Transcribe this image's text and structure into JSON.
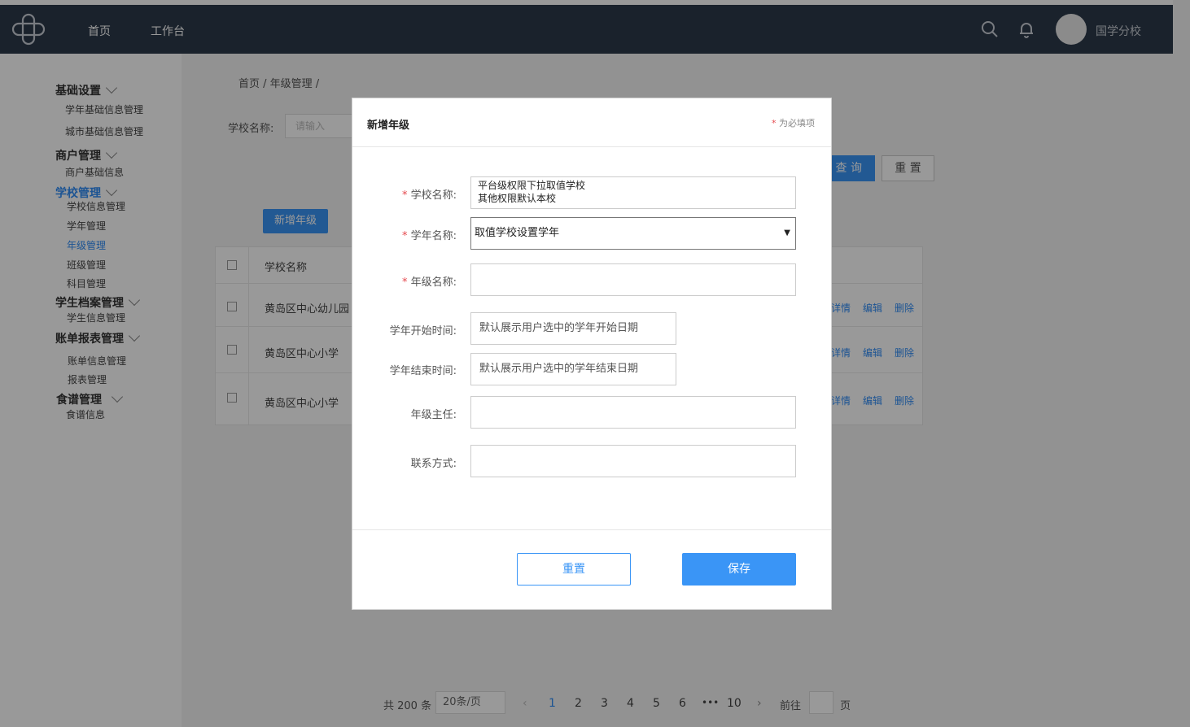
{
  "topbar": {
    "nav": [
      "首页",
      "工作台"
    ],
    "school": "国学分校"
  },
  "sidebar": {
    "groups": [
      {
        "label": "基础设置",
        "items": [
          "学年基础信息管理",
          "城市基础信息管理"
        ]
      },
      {
        "label": "商户管理",
        "items": [
          "商户基础信息"
        ]
      },
      {
        "label": "学校管理",
        "items": [
          "学校信息管理",
          "学年管理",
          "年级管理",
          "班级管理",
          "科目管理"
        ]
      },
      {
        "label": "学生档案管理",
        "items": [
          "学生信息管理"
        ]
      },
      {
        "label": "账单报表管理",
        "items": [
          "账单信息管理",
          "报表管理"
        ]
      },
      {
        "label": "食谱管理",
        "items": [
          "食谱信息"
        ]
      }
    ]
  },
  "page": {
    "breadcrumb": "首页 / 年级管理 /",
    "filter_label": "学校名称:",
    "filter_placeholder": "请输入",
    "query": "查 询",
    "reset": "重 置",
    "add": "新增年级"
  },
  "table": {
    "header": "学校名称",
    "rows": [
      "黄岛区中心幼儿园",
      "黄岛区中心小学",
      "黄岛区中心小学"
    ],
    "ops": [
      "详情",
      "编辑",
      "删除"
    ]
  },
  "pager": {
    "total": "共 200 条",
    "size": "20条/页",
    "pages": [
      "1",
      "2",
      "3",
      "4",
      "5",
      "6",
      "•••",
      "10"
    ],
    "goto": "前往",
    "unit": "页"
  },
  "modal": {
    "title": "新增年级",
    "hint_star": "*",
    "hint": " 为必填项",
    "fields": {
      "school_label": "学校名称:",
      "school_value_line1": "平台级权限下拉取值学校",
      "school_value_line2": "其他权限默认本校",
      "year_label": "学年名称:",
      "year_value": "取值学校设置学年",
      "grade_label": "年级名称:",
      "start_label": "学年开始时间:",
      "start_value": "默认展示用户选中的学年开始日期",
      "end_label": "学年结束时间:",
      "end_value": "默认展示用户选中的学年结束日期",
      "master_label": "年级主任:",
      "contact_label": "联系方式:"
    },
    "reset": "重置",
    "save": "保存"
  }
}
